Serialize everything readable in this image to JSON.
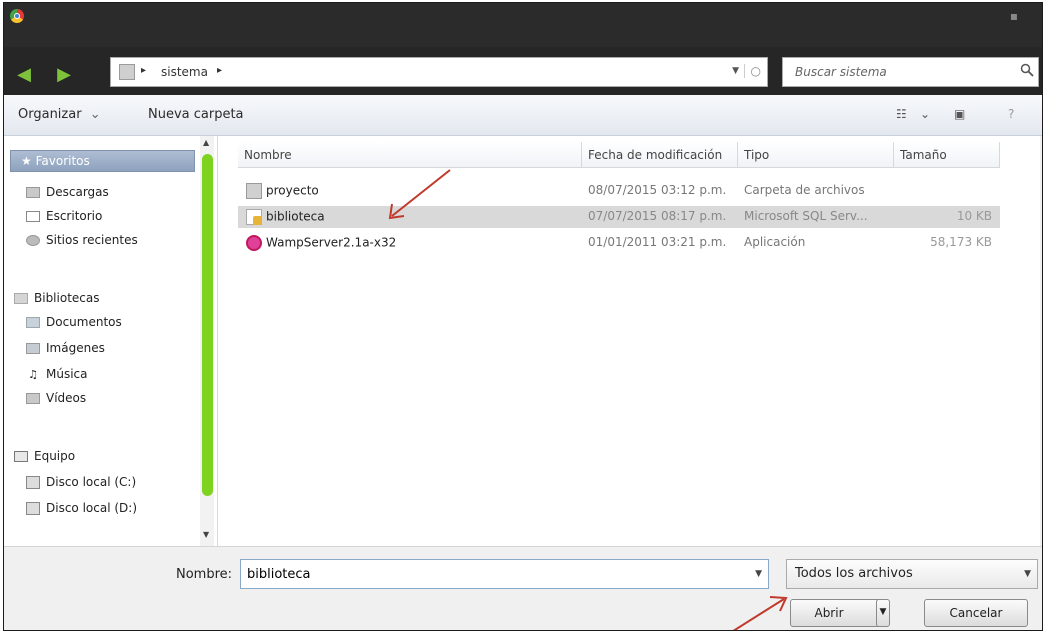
{
  "window": {
    "title_icon": "chrome-icon",
    "nav": {
      "back_icon": "back-arrow-icon",
      "forward_icon": "forward-arrow-icon"
    }
  },
  "address": {
    "path": "sistema",
    "separator": "▸",
    "refresh_icon": "refresh-icon"
  },
  "search": {
    "placeholder": "Buscar sistema",
    "icon": "search-icon"
  },
  "toolbar": {
    "organize_label": "Organizar",
    "organize_chevron": "⌄",
    "new_folder_label": "Nueva carpeta",
    "view_icon": "☷",
    "view_chevron": "⌄",
    "pane_icon": "▣",
    "help_icon": "?"
  },
  "sidebar": {
    "favorites": {
      "label": "Favoritos",
      "star": "★"
    },
    "favorites_items": [
      {
        "label": "Descargas",
        "icon": "downloads-icon"
      },
      {
        "label": "Escritorio",
        "icon": "desktop-icon"
      },
      {
        "label": "Sitios recientes",
        "icon": "recent-places-icon"
      }
    ],
    "libraries": {
      "label": "Bibliotecas",
      "icon": "libraries-icon"
    },
    "libraries_items": [
      {
        "label": "Documentos",
        "icon": "documents-icon"
      },
      {
        "label": "Imágenes",
        "icon": "pictures-icon"
      },
      {
        "label": "Música",
        "icon": "music-icon"
      },
      {
        "label": "Vídeos",
        "icon": "videos-icon"
      }
    ],
    "computer": {
      "label": "Equipo",
      "icon": "computer-icon"
    },
    "computer_items": [
      {
        "label": "Disco local (C:)",
        "icon": "disk-icon"
      },
      {
        "label": "Disco local (D:)",
        "icon": "disk-icon"
      }
    ]
  },
  "columns": {
    "name": "Nombre",
    "modified": "Fecha de modificación",
    "type": "Tipo",
    "size": "Tamaño"
  },
  "files": [
    {
      "name": "proyecto",
      "modified": "08/07/2015 03:12 p.m.",
      "type": "Carpeta de archivos",
      "size": "",
      "icon": "folder-icon"
    },
    {
      "name": "biblioteca",
      "modified": "07/07/2015 08:17 p.m.",
      "type": "Microsoft SQL Serv...",
      "size": "10 KB",
      "icon": "sql-file-icon",
      "selected": true
    },
    {
      "name": "WampServer2.1a-x32",
      "modified": "01/01/2011 03:21 p.m.",
      "type": "Aplicación",
      "size": "58,173 KB",
      "icon": "wampserver-icon"
    }
  ],
  "bottom": {
    "filename_label": "Nombre:",
    "filename_value": "biblioteca",
    "filter_value": "Todos los archivos",
    "open_label": "Abrir",
    "cancel_label": "Cancelar"
  },
  "colors": {
    "title_bar": "#2b2b2b",
    "nav_arrows": "#7ec13a",
    "scrollbar_thumb": "#7ed321",
    "annotation_arrow": "#c0392b",
    "selection": "#d9d9d9"
  }
}
